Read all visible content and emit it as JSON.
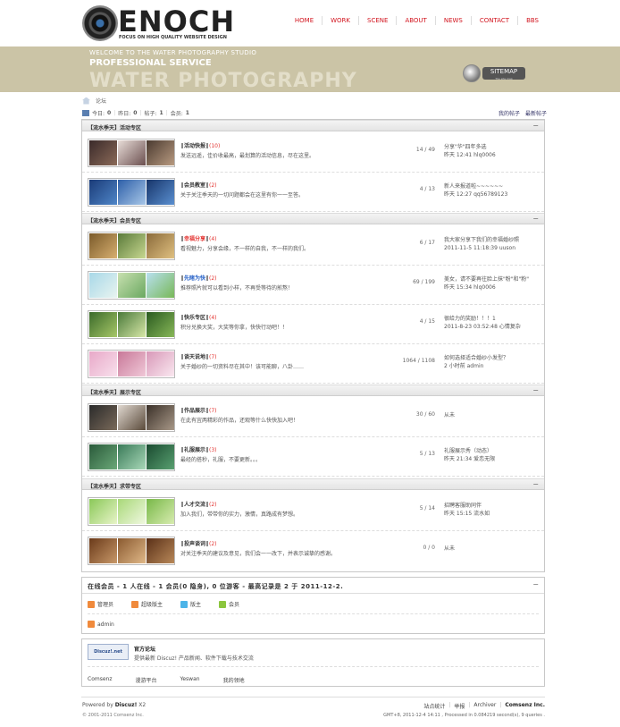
{
  "header": {
    "logo_text": "ENOCH",
    "logo_tagline": "FOCUS ON HIGH QUALITY WEBSITE DESIGN",
    "nav": [
      "HOME",
      "WORK",
      "SCENE",
      "ABOUT",
      "NEWS",
      "CONTACT",
      "BBS"
    ]
  },
  "banner": {
    "line1": "WELCOME TO THE WATER PHOTOGRAPHY STUDIO",
    "line2": "PROFESSIONAL SERVICE",
    "line3": "WATER PHOTOGRAPHY",
    "sitemap_label": "SITEMAP",
    "sitemap_sub": "The site map"
  },
  "breadcrumb": {
    "current": "论坛"
  },
  "stats": {
    "today_label": "今日:",
    "today": "0",
    "yesterday_label": "昨日:",
    "yesterday": "0",
    "posts_label": "帖子:",
    "posts": "1",
    "members_label": "会员:",
    "members": "1"
  },
  "toplinks": [
    "我的帖子",
    "最新帖子"
  ],
  "categories": [
    {
      "title": "【流水季天】活动专区",
      "forums": [
        {
          "name": "活动快报",
          "count": "(10)",
          "desc": "发送远遥，佳价收最高，最划算的活动信息，尽在这里。",
          "nums": "14 / 49",
          "last1": "分享\"华\"四年多选",
          "last2": "昨天 12:41 hlq0006"
        },
        {
          "name": "会员教室",
          "count": "(2)",
          "desc": "关于关注季天的一切问题都会在这里有你一一至答。",
          "nums": "4 / 13",
          "last1": "新人来报道啦~~~~~~",
          "last2": "昨天 12:27 qq56789123"
        }
      ]
    },
    {
      "title": "【流水季天】会员专区",
      "forums": [
        {
          "name": "幸福分享",
          "count": "(4)",
          "desc": "看视魅力，分享会缘，不一样的自我，不一样的我们。",
          "nums": "6 / 17",
          "last1": "我大家分享下我们的幸福婚纱照",
          "last2": "2011-11-5 11:18:39 uuson"
        },
        {
          "name": "先睹为快",
          "count": "(2)",
          "desc": "推荐照片就可以看到小样，不再受等待的煎熬！",
          "nums": "69 / 199",
          "last1": "美女，请不要再往脸上抹\"粉\"和\"粉\"",
          "last2": "昨天 15:34 hlq0006"
        },
        {
          "name": "快乐专区",
          "count": "(4)",
          "desc": "积分兑换大奖，大奖等你拿，快快行动吧！！",
          "nums": "4 / 15",
          "last1": "很给力的奖励！！！1",
          "last2": "2011-8-23 03:52:48 心情复杂"
        },
        {
          "name": "谈天说地",
          "count": "(7)",
          "desc": "关于婚纱的一切资料尽在其中！该可能聊，八卦……",
          "nums": "1064 / 1108",
          "last1": "如何选择适合婚纱小发型？",
          "last2": "2 小时前 admin"
        }
      ]
    },
    {
      "title": "【流水季天】展示专区",
      "forums": [
        {
          "name": "作品展示",
          "count": "(7)",
          "desc": "在此有宜两精彩的作品，还观等什么快快加入吧！",
          "nums": "30 / 60",
          "last1": "从未",
          "last2": ""
        },
        {
          "name": "礼服展示",
          "count": "(3)",
          "desc": "最经的搭秒，礼服，不要更新。。。",
          "nums": "5 / 13",
          "last1": "礼服展示秀（动态）",
          "last2": "昨天 21:34 爱恋无限"
        }
      ]
    },
    {
      "title": "【流水季天】求带专区",
      "forums": [
        {
          "name": "人才交流",
          "count": "(2)",
          "desc": "加入我们，带带你的实力，激情，真路成有梦想。",
          "nums": "5 / 14",
          "last1": "招聘客服助同伴",
          "last2": "昨天 15:15 流水如"
        },
        {
          "name": "投声谈词",
          "count": "(2)",
          "desc": "对关注季天的建议及意见，我们会一一改下，并表示诚挚的感谢。",
          "nums": "0 / 0",
          "last1": "从未",
          "last2": ""
        }
      ]
    }
  ],
  "online": {
    "header": "在线会员 - 1 人在线 - 1 会员(0 隐身), 0 位游客 - 最高记录是 2 于 2011-12-2.",
    "legend": [
      {
        "label": "管理员",
        "color": "#f08a3c"
      },
      {
        "label": "超级版主",
        "color": "#f08a3c"
      },
      {
        "label": "版主",
        "color": "#4db4e8"
      },
      {
        "label": "会员",
        "color": "#8cc63e"
      }
    ],
    "user": "admin"
  },
  "official": {
    "logo_text": "Discuz!.net",
    "title": "官方论坛",
    "desc": "提供最新 Discuz! 产品新闻、软件下载与技术交流",
    "links": [
      "Comsenz",
      "漫游平台",
      "Yeswan",
      "我的领地"
    ]
  },
  "footer": {
    "powered_prefix": "Powered by",
    "powered_brand": "Discuz!",
    "powered_version": "X2",
    "copyright": "© 2001-2011 Comsenz Inc.",
    "links": [
      "站点统计",
      "举报",
      "Archiver"
    ],
    "company": "Comsenz Inc.",
    "gmt": "GMT+8, 2011-12-4 14:11 , Processed in 0.084219 second(s), 9 queries ."
  }
}
